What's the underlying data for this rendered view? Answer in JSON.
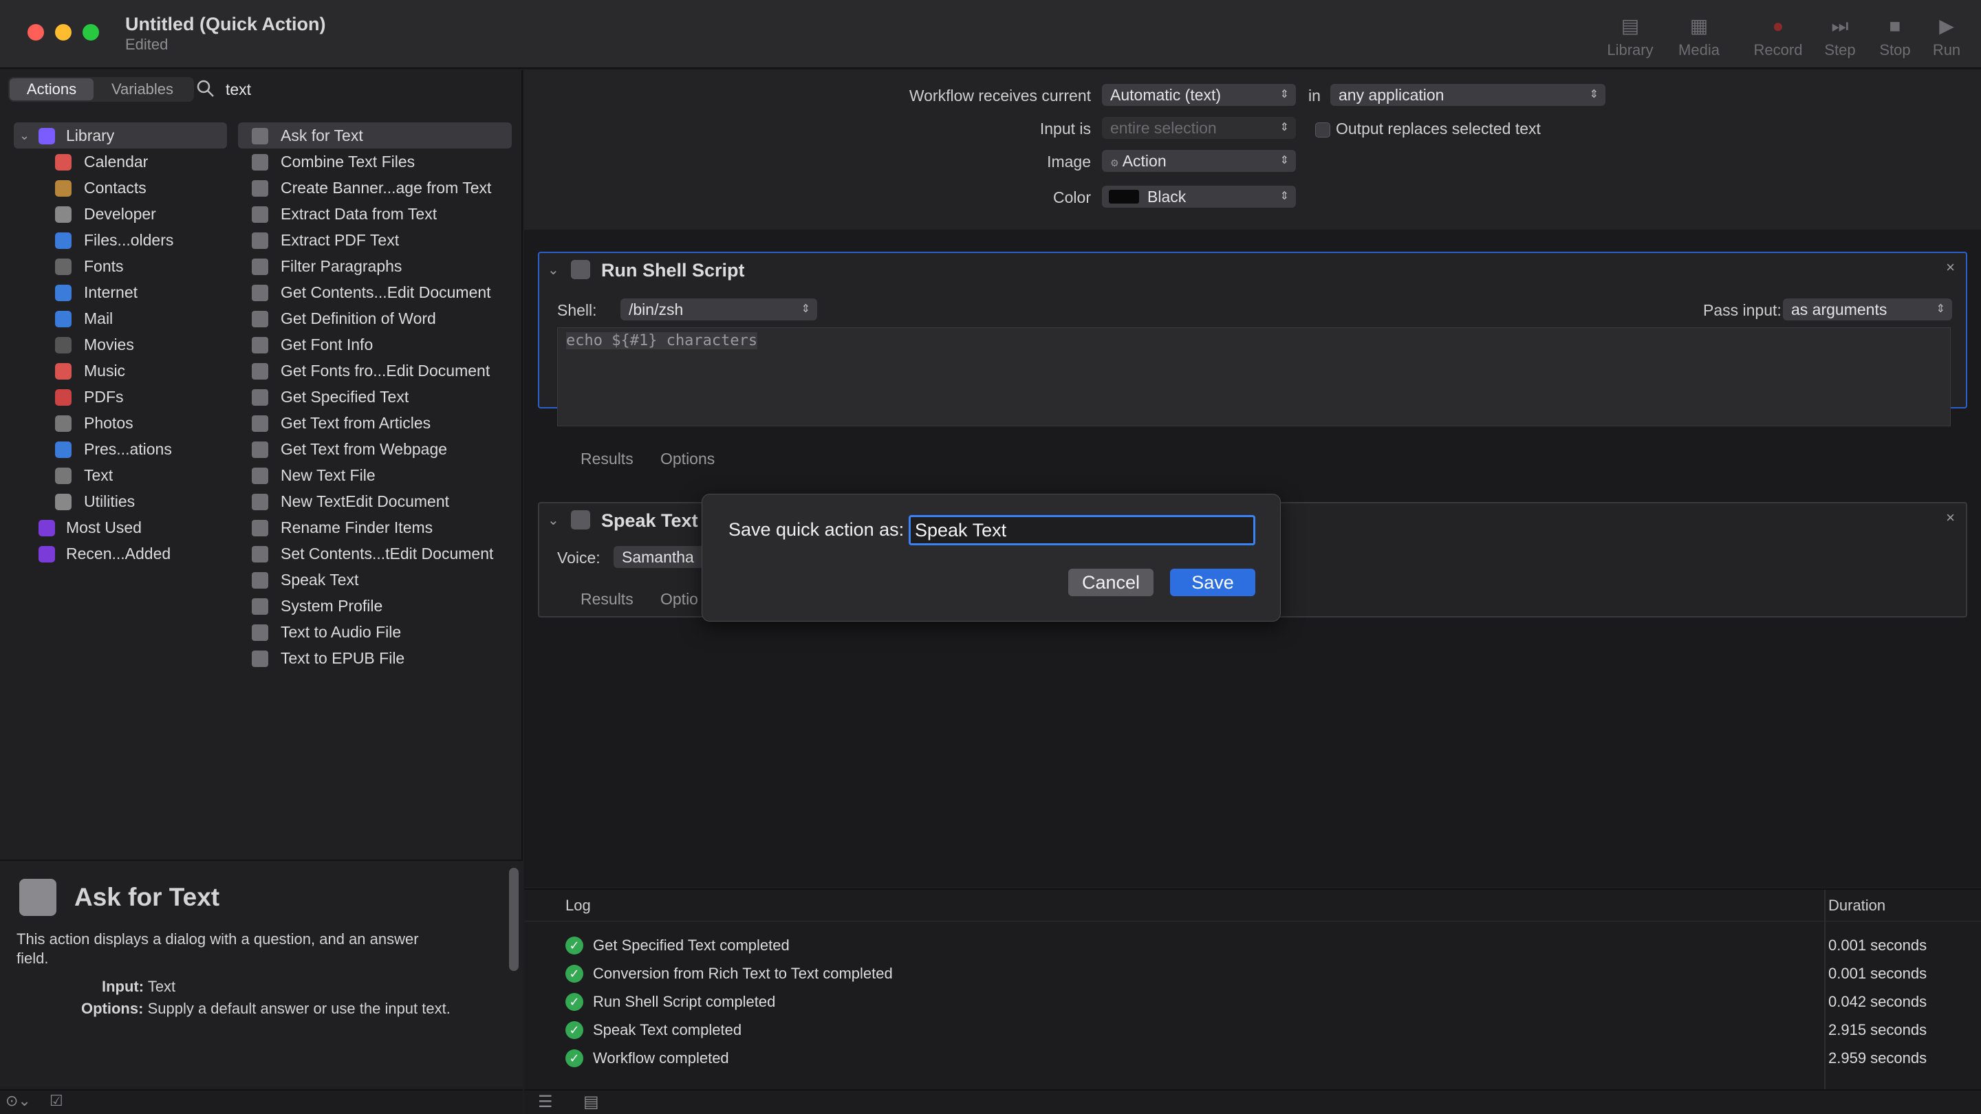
{
  "window": {
    "title": "Untitled (Quick Action)",
    "subtitle": "Edited"
  },
  "toolbar": {
    "library": "Library",
    "media": "Media",
    "record": "Record",
    "step": "Step",
    "stop": "Stop",
    "run": "Run"
  },
  "sidebar": {
    "tab_actions": "Actions",
    "tab_variables": "Variables",
    "search_value": "text",
    "categories": [
      "Library",
      "Calendar",
      "Contacts",
      "Developer",
      "Files...olders",
      "Fonts",
      "Internet",
      "Mail",
      "Movies",
      "Music",
      "PDFs",
      "Photos",
      "Pres...ations",
      "Text",
      "Utilities",
      "Most Used",
      "Recen...Added"
    ],
    "actions": [
      "Ask for Text",
      "Combine Text Files",
      "Create Banner...age from Text",
      "Extract Data from Text",
      "Extract PDF Text",
      "Filter Paragraphs",
      "Get Contents...Edit Document",
      "Get Definition of Word",
      "Get Font Info",
      "Get Fonts fro...Edit Document",
      "Get Specified Text",
      "Get Text from Articles",
      "Get Text from Webpage",
      "New Text File",
      "New TextEdit Document",
      "Rename Finder Items",
      "Set Contents...tEdit Document",
      "Speak Text",
      "System Profile",
      "Text to Audio File",
      "Text to EPUB File"
    ]
  },
  "description": {
    "title": "Ask for Text",
    "body": "This action displays a dialog with a question, and an answer field.",
    "input_label": "Input:",
    "input_value": "Text",
    "options_label": "Options:",
    "options_value": "Supply a default answer or use the input text."
  },
  "workflow": {
    "receives_label": "Workflow receives current",
    "receives_value": "Automatic (text)",
    "in_label": "in",
    "in_value": "any application",
    "input_is_label": "Input is",
    "input_is_value": "entire selection",
    "output_replaces": "Output replaces selected text",
    "image_label": "Image",
    "image_value": "Action",
    "color_label": "Color",
    "color_value": "Black"
  },
  "shell_action": {
    "title": "Run Shell Script",
    "shell_label": "Shell:",
    "shell_value": "/bin/zsh",
    "pass_input_label": "Pass input:",
    "pass_input_value": "as arguments",
    "script": "echo ${#1} characters",
    "tab_results": "Results",
    "tab_options": "Options"
  },
  "speak_action": {
    "title": "Speak Text",
    "voice_label": "Voice:",
    "voice_value": "Samantha",
    "tab_results": "Results",
    "tab_options": "Options"
  },
  "sheet": {
    "label": "Save quick action as:",
    "value": "Speak Text",
    "cancel": "Cancel",
    "save": "Save"
  },
  "log": {
    "col_log": "Log",
    "col_duration": "Duration",
    "rows": [
      {
        "msg": "Get Specified Text completed",
        "dur": "0.001 seconds"
      },
      {
        "msg": "Conversion from Rich Text to Text completed",
        "dur": "0.001 seconds"
      },
      {
        "msg": "Run Shell Script completed",
        "dur": "0.042 seconds"
      },
      {
        "msg": "Speak Text completed",
        "dur": "2.915 seconds"
      },
      {
        "msg": "Workflow completed",
        "dur": "2.959 seconds"
      }
    ]
  },
  "colors": {
    "accent": "#2d6fe0",
    "success": "#34a853",
    "selection_border": "#2c5fc7"
  }
}
